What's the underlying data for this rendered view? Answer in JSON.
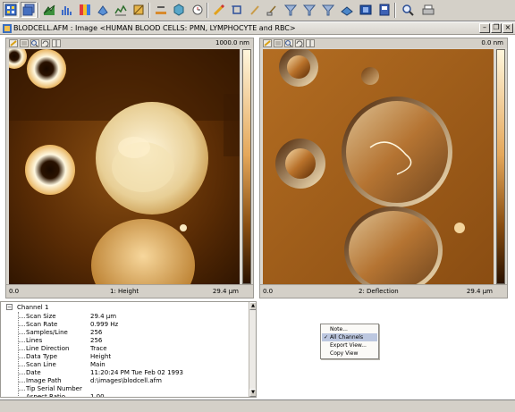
{
  "window": {
    "title": "BLODCELL.AFM : Image <HUMAN BLOOD CELLS: PMN, LYMPHOCYTE and RBC>",
    "buttons": {
      "minimize": "–",
      "restore": "❐",
      "close": "×"
    }
  },
  "toolbar": {
    "icons": [
      "channel-select",
      "layers",
      "display-3d",
      "histogram",
      "color-table",
      "surface",
      "cut-profile",
      "sharpen",
      "flatten",
      "pencil",
      "crop",
      "brush",
      "clean",
      "filter-1",
      "filter-2",
      "filter-3",
      "mesh-3d",
      "view-3d",
      "zoom",
      "print"
    ]
  },
  "panels": [
    {
      "label": "1: Height",
      "x_start": "0.0",
      "x_end": "29.4 µm",
      "top_value": "1000.0 nm"
    },
    {
      "label": "2: Deflection",
      "x_start": "0.0",
      "x_end": "29.4 µm",
      "top_value": "0.0 nm"
    }
  ],
  "info": {
    "group": "Channel 1",
    "rows": [
      {
        "key": "Scan Size",
        "value": "29.4 µm"
      },
      {
        "key": "Scan Rate",
        "value": "0.999 Hz"
      },
      {
        "key": "Samples/Line",
        "value": "256"
      },
      {
        "key": "Lines",
        "value": "256"
      },
      {
        "key": "Line Direction",
        "value": "Trace"
      },
      {
        "key": "Data Type",
        "value": "Height"
      },
      {
        "key": "Scan Line",
        "value": "Main"
      },
      {
        "key": "Date",
        "value": "11:20:24 PM Tue Feb 02 1993"
      },
      {
        "key": "Image Path",
        "value": "d:\\images\\blodcell.afm"
      },
      {
        "key": "Tip Serial Number",
        "value": ""
      },
      {
        "key": "Aspect Ratio",
        "value": "1.00"
      }
    ]
  },
  "context_menu": {
    "items": [
      {
        "label": "Note...",
        "checked": false,
        "selected": false
      },
      {
        "label": "All Channels",
        "checked": true,
        "selected": true
      },
      {
        "label": "Export View...",
        "checked": false,
        "selected": false
      },
      {
        "label": "Copy View",
        "checked": false,
        "selected": false
      }
    ]
  },
  "colors": {
    "afm_dark": "#2a1200",
    "afm_mid": "#b06a1c",
    "afm_light": "#fff6dc",
    "menu_highlight": "#bcc7df"
  }
}
